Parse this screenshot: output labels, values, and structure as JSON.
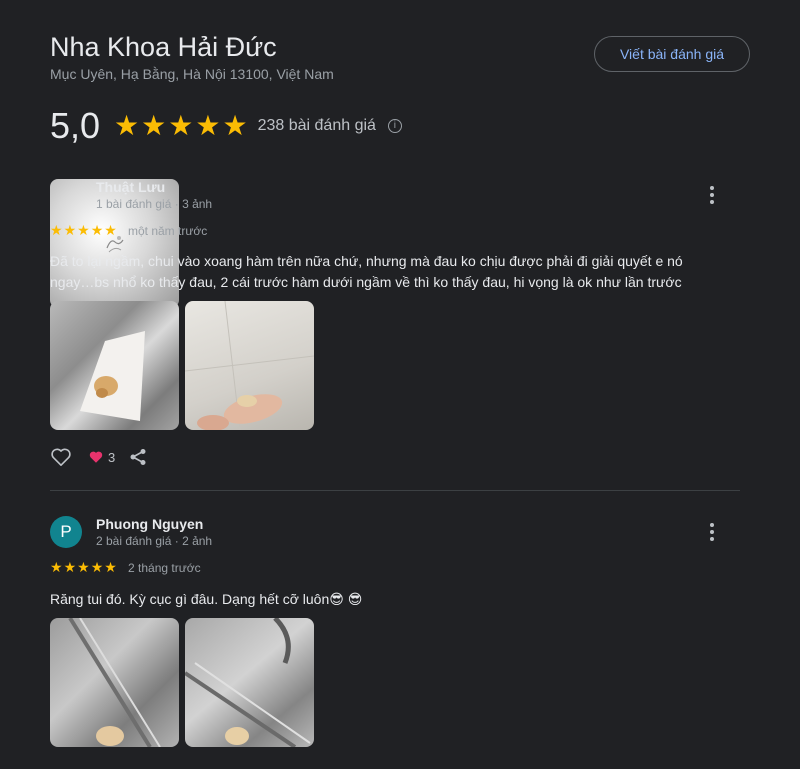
{
  "place": {
    "name": "Nha Khoa Hải Đức",
    "address": "Mục Uyên, Hạ Bằng, Hà Nội 13100, Việt Nam",
    "write_review_label": "Viết bài đánh giá"
  },
  "summary": {
    "rating": "5,0",
    "stars": 5,
    "review_count": "238 bài đánh giá",
    "info_icon": "info-icon"
  },
  "reviews": [
    {
      "name": "Thuật Lưu",
      "meta": "1 bài đánh giá · 3 ảnh",
      "avatar_icon": "profile-photo",
      "stars": 5,
      "time": "một năm trước",
      "text": "Đã to lại ngầm, chui vào xoang hàm trên nữa chứ, nhưng mà đau ko chịu được phải đi giải quyết e nó ngay…bs nhổ ko thấy đau, 2 cái trước hàm dưới ngầm về thì ko thấy đau, hi vọng là ok như lần trước",
      "reaction_count": "3"
    },
    {
      "name": "Phuong Nguyen",
      "meta": "2 bài đánh giá · 2 ảnh",
      "avatar_letter": "P",
      "stars": 5,
      "time": "2 tháng trước",
      "text": "Răng tui đó. Kỳ cục gì đâu. Dạng hết cỡ luôn😎 😎"
    }
  ],
  "colors": {
    "background": "#202124",
    "accent": "#8ab4f8",
    "star": "#fbbc04",
    "avatar_p": "#11848f",
    "reaction_heart": "#e8336d"
  }
}
